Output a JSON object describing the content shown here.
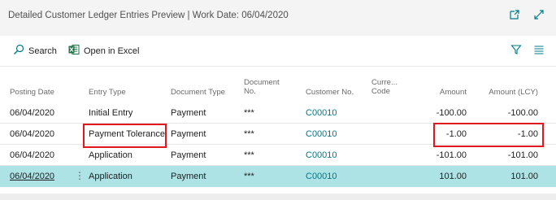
{
  "window": {
    "title": "Detailed Customer Ledger Entries Preview | Work Date: 06/04/2020"
  },
  "actions": {
    "search_label": "Search",
    "excel_label": "Open in Excel"
  },
  "columns": {
    "posting_date": "Posting Date",
    "entry_type": "Entry Type",
    "document_type": "Document Type",
    "document_no_1": "Document",
    "document_no_2": "No.",
    "customer_no": "Customer No.",
    "currency_code_1": "Curre...",
    "currency_code_2": "Code",
    "amount": "Amount",
    "amount_lcy": "Amount (LCY)"
  },
  "rows": [
    {
      "posting_date": "06/04/2020",
      "entry_type": "Initial Entry",
      "document_type": "Payment",
      "document_no": "***",
      "customer_no": "C00010",
      "currency_code": "",
      "amount": "-100.00",
      "amount_lcy": "-100.00"
    },
    {
      "posting_date": "06/04/2020",
      "entry_type": "Payment Tolerance",
      "document_type": "Payment",
      "document_no": "***",
      "customer_no": "C00010",
      "currency_code": "",
      "amount": "-1.00",
      "amount_lcy": "-1.00"
    },
    {
      "posting_date": "06/04/2020",
      "entry_type": "Application",
      "document_type": "Payment",
      "document_no": "***",
      "customer_no": "C00010",
      "currency_code": "",
      "amount": "-101.00",
      "amount_lcy": "-101.00"
    },
    {
      "posting_date": "06/04/2020",
      "entry_type": "Application",
      "document_type": "Payment",
      "document_no": "***",
      "customer_no": "C00010",
      "currency_code": "",
      "amount": "101.00",
      "amount_lcy": "101.00"
    }
  ],
  "colors": {
    "accent": "#00788a",
    "selected_row": "#aee3e6",
    "highlight_box": "#e0181f",
    "excel_green": "#1e7145"
  },
  "icons": {
    "popout": "popout-icon",
    "expand": "expand-icon",
    "search": "search-icon",
    "excel": "excel-icon",
    "filter": "filter-icon",
    "list_view": "list-view-icon",
    "row_menu": "more-options-icon"
  }
}
